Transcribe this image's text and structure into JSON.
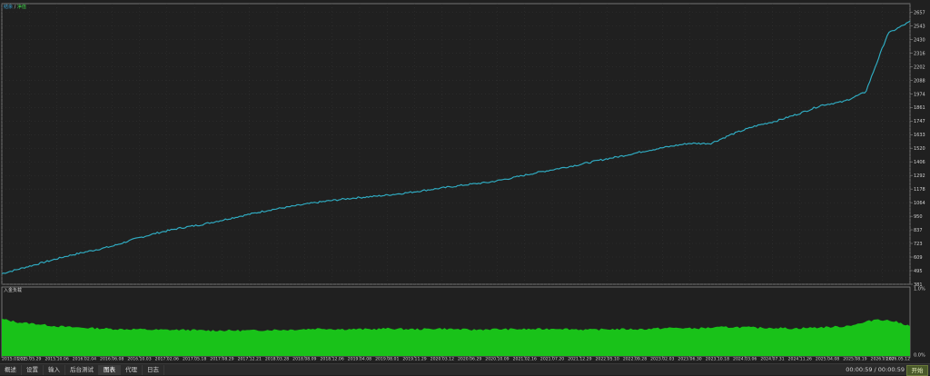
{
  "legend": {
    "balance": "结余",
    "separator": " / ",
    "equity": "净值"
  },
  "sub_panel_label": "入金负载",
  "tabs": [
    "概述",
    "设置",
    "输入",
    "后台测试",
    "图表",
    "代理",
    "日志"
  ],
  "active_tab": 4,
  "timer": "00:00:59 / 00:00:59",
  "start_label": "开始",
  "colors": {
    "balance_line": "#3fa7d8",
    "equity_line": "#1fa8a0",
    "deposit_fill": "#19c219",
    "background": "#202020",
    "grid": "#3a3a3a"
  },
  "chart_data": [
    {
      "type": "line",
      "title": "",
      "y_ticks": [
        381,
        495,
        609,
        723,
        837,
        950,
        1064,
        1178,
        1292,
        1406,
        1520,
        1633,
        1747,
        1861,
        1974,
        2088,
        2202,
        2316,
        2430,
        2543,
        2657
      ],
      "ylim": [
        381,
        2700
      ],
      "x_ticks": [
        "2015.01.12",
        "2015.05.29",
        "2015.10.06",
        "2016.02.04",
        "2016.06.08",
        "2016.10.03",
        "2017.02.06",
        "2017.05.18",
        "2017.08.29",
        "2017.12.21",
        "2018.03.28",
        "2018.08.09",
        "2018.12.06",
        "2019.04.08",
        "2019.08.01",
        "2019.11.29",
        "2020.03.12",
        "2020.06.29",
        "2020.10.09",
        "2021.02.16",
        "2021.07.20",
        "2021.12.29",
        "2022.05.10",
        "2022.09.28",
        "2023.02.03",
        "2023.06.30",
        "2023.10.18",
        "2024.03.06",
        "2024.07.31",
        "2024.11.26",
        "2025.04.08",
        "2025.08.19",
        "2026.01.07",
        "2026.05.12"
      ],
      "series": [
        {
          "name": "结余",
          "values": [
            470,
            520,
            570,
            620,
            660,
            700,
            760,
            810,
            850,
            880,
            920,
            960,
            1000,
            1030,
            1060,
            1085,
            1105,
            1120,
            1140,
            1165,
            1190,
            1215,
            1235,
            1270,
            1310,
            1345,
            1380,
            1420,
            1455,
            1495,
            1530,
            1560,
            1560,
            1640,
            1705,
            1750,
            1810,
            1880,
            1910,
            1990,
            2480,
            2580
          ]
        }
      ]
    },
    {
      "type": "area",
      "title": "",
      "y_ticks": [
        "0.0%",
        "1.0%"
      ],
      "ylim": [
        0,
        1
      ],
      "series": [
        {
          "name": "",
          "values": [
            0.55,
            0.5,
            0.48,
            0.45,
            0.43,
            0.42,
            0.41,
            0.4,
            0.4,
            0.39,
            0.39,
            0.39,
            0.38,
            0.38,
            0.38,
            0.38,
            0.39,
            0.39,
            0.4,
            0.41,
            0.4,
            0.4,
            0.4,
            0.41,
            0.4,
            0.4,
            0.41,
            0.4,
            0.39,
            0.4,
            0.4,
            0.4,
            0.4,
            0.41,
            0.4,
            0.39,
            0.4,
            0.4,
            0.4,
            0.41,
            0.42,
            0.41,
            0.42,
            0.43,
            0.43,
            0.42,
            0.42,
            0.41,
            0.42,
            0.43,
            0.44,
            0.48,
            0.55,
            0.52,
            0.45
          ]
        }
      ]
    }
  ]
}
